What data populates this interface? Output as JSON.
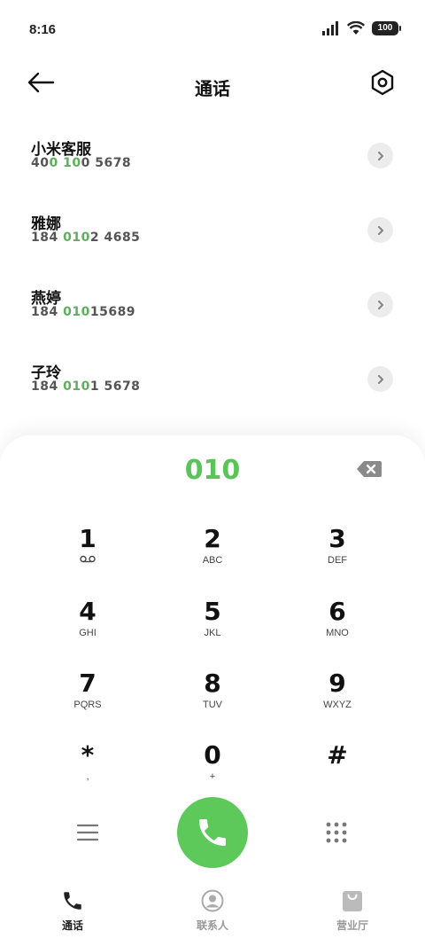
{
  "status_bar": {
    "time": "8:16",
    "battery": "100"
  },
  "header": {
    "title": "通话",
    "back_icon": "arrow-left-icon",
    "settings_icon": "hexagon-settings-icon"
  },
  "contacts": [
    {
      "name": "小米客服",
      "number_parts": [
        {
          "t": "40",
          "h": false
        },
        {
          "t": "0",
          "h": true
        },
        {
          "t": " ",
          "h": false
        },
        {
          "t": "10",
          "h": true
        },
        {
          "t": "0 5678",
          "h": false
        }
      ]
    },
    {
      "name": "雅娜",
      "number_parts": [
        {
          "t": "184 ",
          "h": false
        },
        {
          "t": "010",
          "h": true
        },
        {
          "t": "2 4685",
          "h": false
        }
      ]
    },
    {
      "name": "燕婷",
      "number_parts": [
        {
          "t": "184 ",
          "h": false
        },
        {
          "t": "010",
          "h": true
        },
        {
          "t": "15689",
          "h": false
        }
      ]
    },
    {
      "name": "子玲",
      "number_parts": [
        {
          "t": "184 ",
          "h": false
        },
        {
          "t": "010",
          "h": true
        },
        {
          "t": "1 5678",
          "h": false
        }
      ]
    }
  ],
  "dialer": {
    "input": "010",
    "keys": [
      {
        "digit": "1",
        "letters": "",
        "icon": "voicemail-icon"
      },
      {
        "digit": "2",
        "letters": "ABC"
      },
      {
        "digit": "3",
        "letters": "DEF"
      },
      {
        "digit": "4",
        "letters": "GHI"
      },
      {
        "digit": "5",
        "letters": "JKL"
      },
      {
        "digit": "6",
        "letters": "MNO"
      },
      {
        "digit": "7",
        "letters": "PQRS"
      },
      {
        "digit": "8",
        "letters": "TUV"
      },
      {
        "digit": "9",
        "letters": "WXYZ"
      },
      {
        "digit": "*",
        "letters": ","
      },
      {
        "digit": "0",
        "letters": "+"
      },
      {
        "digit": "#",
        "letters": ""
      }
    ]
  },
  "bottom_nav": [
    {
      "label": "通话",
      "icon": "phone-icon",
      "active": true
    },
    {
      "label": "联系人",
      "icon": "contacts-icon",
      "active": false
    },
    {
      "label": "营业厅",
      "icon": "shopping-bag-icon",
      "active": false
    }
  ],
  "colors": {
    "accent": "#5cc95a",
    "highlight": "#5ab25a"
  }
}
